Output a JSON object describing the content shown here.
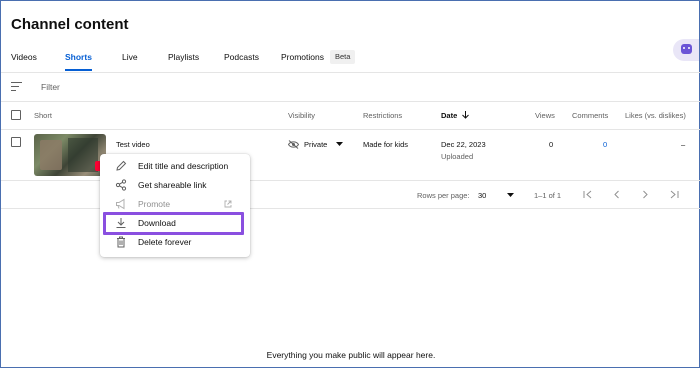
{
  "page": {
    "title": "Channel content"
  },
  "tabs": [
    {
      "label": "Videos"
    },
    {
      "label": "Shorts",
      "active": true
    },
    {
      "label": "Live"
    },
    {
      "label": "Playlists"
    },
    {
      "label": "Podcasts"
    },
    {
      "label": "Promotions"
    }
  ],
  "beta_badge": "Beta",
  "filter": {
    "placeholder": "Filter"
  },
  "table": {
    "columns": {
      "short": "Short",
      "visibility": "Visibility",
      "restrictions": "Restrictions",
      "date": "Date",
      "views": "Views",
      "comments": "Comments",
      "likes": "Likes (vs. dislikes)"
    },
    "rows": [
      {
        "title": "Test video",
        "visibility": "Private",
        "restrictions": "Made for kids",
        "date": "Dec 22, 2023",
        "date_status": "Uploaded",
        "views": "0",
        "comments": "0",
        "likes": "–"
      }
    ]
  },
  "pagination": {
    "rows_per_page_label": "Rows per page:",
    "rows_per_page_value": "30",
    "range": "1–1 of 1"
  },
  "context_menu": {
    "items": [
      {
        "label": "Edit title and description",
        "icon": "pencil-icon"
      },
      {
        "label": "Get shareable link",
        "icon": "share-icon"
      },
      {
        "label": "Promote",
        "icon": "megaphone-icon",
        "disabled": true
      },
      {
        "label": "Download",
        "icon": "download-icon",
        "highlighted": true
      },
      {
        "label": "Delete forever",
        "icon": "trash-icon"
      }
    ]
  },
  "empty_message": "Everything you make public will appear here.",
  "colors": {
    "accent": "#065fd4",
    "highlight": "#8a4fe0",
    "shorts_red": "#ff0033"
  }
}
